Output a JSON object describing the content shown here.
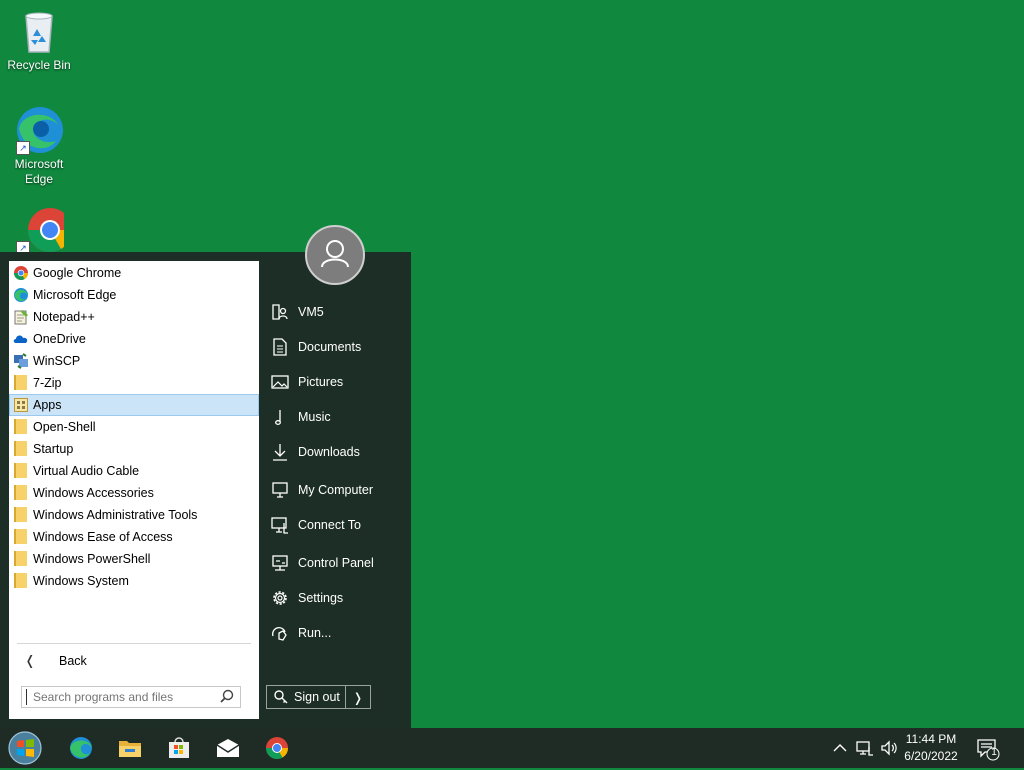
{
  "desktop": {
    "icons": [
      {
        "name": "Recycle Bin"
      },
      {
        "name": "Microsoft Edge"
      },
      {
        "name": "Google Chrome"
      }
    ]
  },
  "start_menu": {
    "programs": [
      {
        "label": "Google Chrome",
        "icon": "chrome-icon"
      },
      {
        "label": "Microsoft Edge",
        "icon": "edge-icon"
      },
      {
        "label": "Notepad++",
        "icon": "notepad-icon"
      },
      {
        "label": "OneDrive",
        "icon": "cloud-icon"
      },
      {
        "label": "WinSCP",
        "icon": "winscp-icon"
      },
      {
        "label": "7-Zip",
        "icon": "folder-icon"
      },
      {
        "label": "Apps",
        "icon": "apps-icon",
        "selected": true
      },
      {
        "label": "Open-Shell",
        "icon": "folder-icon"
      },
      {
        "label": "Startup",
        "icon": "folder-icon"
      },
      {
        "label": "Virtual Audio Cable",
        "icon": "folder-icon"
      },
      {
        "label": "Windows Accessories",
        "icon": "folder-icon"
      },
      {
        "label": "Windows Administrative Tools",
        "icon": "folder-icon"
      },
      {
        "label": "Windows Ease of Access",
        "icon": "folder-icon"
      },
      {
        "label": "Windows PowerShell",
        "icon": "folder-icon"
      },
      {
        "label": "Windows System",
        "icon": "folder-icon"
      }
    ],
    "back_label": "Back",
    "search_placeholder": "Search programs and files",
    "side_items": [
      {
        "label": "VM5",
        "icon": "user-folder-icon"
      },
      {
        "label": "Documents",
        "icon": "document-icon"
      },
      {
        "label": "Pictures",
        "icon": "picture-icon"
      },
      {
        "label": "Music",
        "icon": "music-icon"
      },
      {
        "label": "Downloads",
        "icon": "download-icon"
      },
      {
        "label": "My Computer",
        "icon": "computer-icon"
      },
      {
        "label": "Connect To",
        "icon": "network-icon"
      },
      {
        "label": "Control Panel",
        "icon": "control-panel-icon"
      },
      {
        "label": "Settings",
        "icon": "gear-icon"
      },
      {
        "label": "Run...",
        "icon": "run-icon"
      }
    ],
    "sign_out_label": "Sign out"
  },
  "taskbar": {
    "pinned": [
      "edge-icon",
      "file-explorer-icon",
      "store-icon",
      "mail-icon",
      "chrome-icon"
    ],
    "time": "11:44 PM",
    "date": "6/20/2022",
    "notification_count": "1"
  }
}
